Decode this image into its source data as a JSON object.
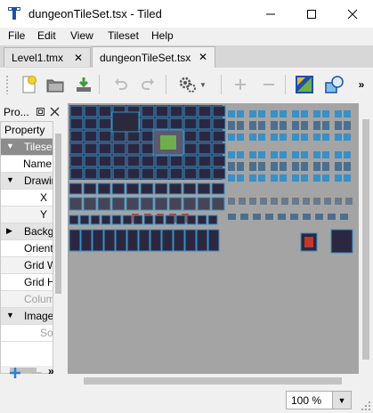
{
  "window": {
    "title": "dungeonTileSet.tsx - Tiled"
  },
  "menu": [
    "File",
    "Edit",
    "View",
    "Tileset",
    "Help"
  ],
  "tabs": [
    {
      "label": "Level1.tmx",
      "active": false
    },
    {
      "label": "dungeonTileSet.tsx",
      "active": true
    }
  ],
  "properties": {
    "title": "Pro...",
    "header": "Property",
    "rows": [
      {
        "label": "Tileset",
        "kind": "selected",
        "arrow": "▼"
      },
      {
        "label": "Name",
        "kind": "right"
      },
      {
        "label": "Drawing",
        "kind": "group",
        "arrow": "▼"
      },
      {
        "label": "X",
        "kind": "right"
      },
      {
        "label": "Y",
        "kind": "right"
      },
      {
        "label": "Background",
        "kind": "group",
        "arrow": "▶"
      },
      {
        "label": "Orientation",
        "kind": "plain"
      },
      {
        "label": "Grid Width",
        "kind": "plain"
      },
      {
        "label": "Grid Height",
        "kind": "plain"
      },
      {
        "label": "Columns",
        "kind": "disabled"
      },
      {
        "label": "Image",
        "kind": "group",
        "arrow": "▼"
      },
      {
        "label": "Source",
        "kind": "disabled-right"
      }
    ]
  },
  "status": {
    "zoom": "100 %"
  },
  "colors": {
    "tile_blue": "#3a8fc4",
    "tile_dark": "#2c2740",
    "canvas_bg": "#a4a4a4",
    "accent_green": "#6fae4d"
  }
}
